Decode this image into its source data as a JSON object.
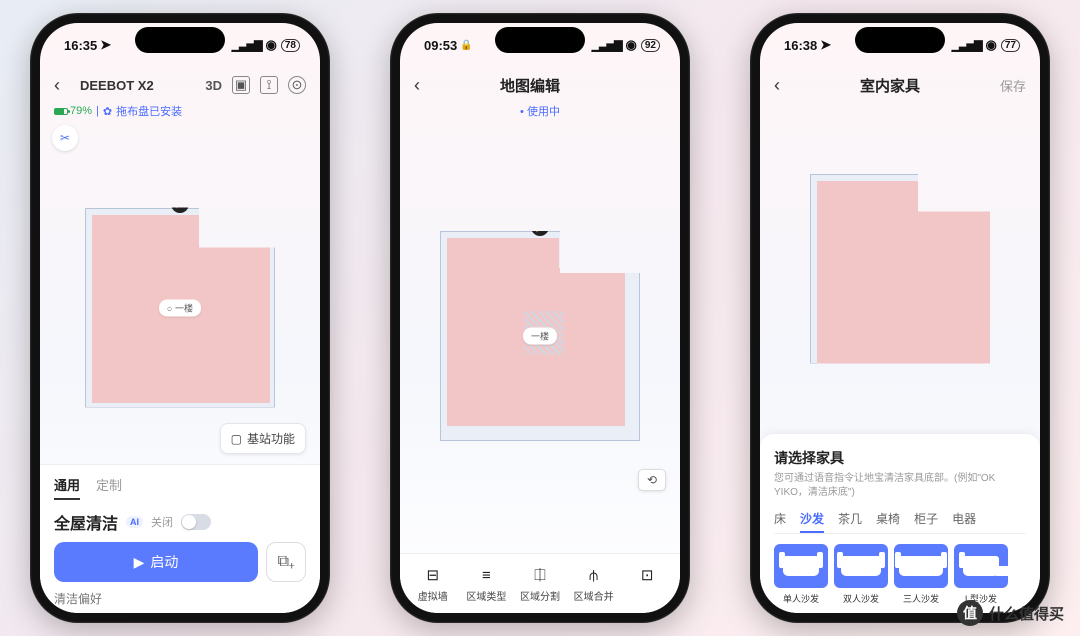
{
  "watermark": "什么值得买",
  "phone1": {
    "status": {
      "time": "16:35",
      "battery": "78"
    },
    "header": {
      "title": "DEEBOT X2",
      "mode3d": "3D"
    },
    "row2": {
      "battery_pct": "79%",
      "mop_status": "拖布盘已安装"
    },
    "map": {
      "floor_label": "○ 一楼"
    },
    "base_btn": "基站功能",
    "tabs": {
      "general": "通用",
      "custom": "定制"
    },
    "clean": {
      "title": "全屋清洁",
      "ai": "AI",
      "off": "关闭"
    },
    "start": "启动",
    "pref": "清洁偏好"
  },
  "phone2": {
    "status": {
      "time": "09:53",
      "battery": "92"
    },
    "header": {
      "title": "地图编辑"
    },
    "sub_tag": "• 使用中",
    "map": {
      "floor_label": "一楼"
    },
    "nav": [
      {
        "label": "虚拟墙"
      },
      {
        "label": "区域类型"
      },
      {
        "label": "区域分割"
      },
      {
        "label": "区域合并"
      }
    ]
  },
  "phone3": {
    "status": {
      "time": "16:38",
      "battery": "77"
    },
    "header": {
      "title": "室内家具",
      "save": "保存"
    },
    "panel": {
      "title": "请选择家具",
      "sub": "您可通过语音指令让地宝清洁家具底部。(例如\"OK YIKO，清洁床底\")",
      "cats": [
        "床",
        "沙发",
        "茶几",
        "桌椅",
        "柜子",
        "电器"
      ],
      "active_cat": 1,
      "items": [
        "单人沙发",
        "双人沙发",
        "三人沙发",
        "L型沙发"
      ]
    }
  }
}
